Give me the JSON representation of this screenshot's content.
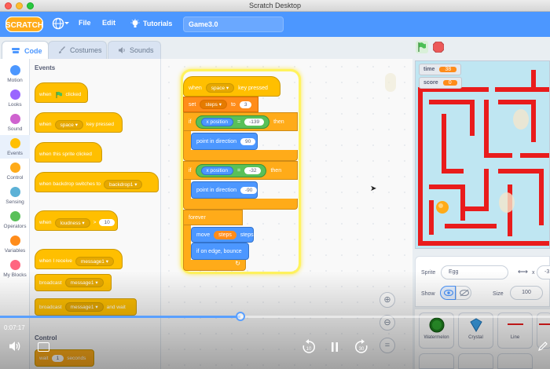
{
  "window": {
    "title": "Scratch Desktop"
  },
  "menu": {
    "logo": "SCRATCH",
    "file": "File",
    "edit": "Edit",
    "tutorials": "Tutorials",
    "project_title": "Game3.0"
  },
  "tabs": {
    "code": "Code",
    "costumes": "Costumes",
    "sounds": "Sounds"
  },
  "categories": [
    {
      "label": "Motion",
      "color": "#4c97ff"
    },
    {
      "label": "Looks",
      "color": "#9966ff"
    },
    {
      "label": "Sound",
      "color": "#cf63cf"
    },
    {
      "label": "Events",
      "color": "#ffbf00"
    },
    {
      "label": "Control",
      "color": "#ffab19"
    },
    {
      "label": "Sensing",
      "color": "#5cb1d6"
    },
    {
      "label": "Operators",
      "color": "#59c059"
    },
    {
      "label": "Variables",
      "color": "#ff8c1a"
    },
    {
      "label": "My Blocks",
      "color": "#ff6680"
    }
  ],
  "palette": {
    "events_title": "Events",
    "control_title": "Control",
    "when": "when",
    "clicked": "clicked",
    "space": "space",
    "key_pressed": "key pressed",
    "when_sprite_clicked": "when this sprite clicked",
    "when_backdrop": "when backdrop switches to",
    "backdrop1": "backdrop1",
    "loudness": "loudness",
    "gt": ">",
    "loud_val": "10",
    "when_i_receive": "when I receive",
    "message1": "message1",
    "broadcast": "broadcast",
    "and_wait": "and wait",
    "wait": "wait",
    "wait_val": "1",
    "seconds": "seconds"
  },
  "script": {
    "when": "when",
    "key": "space",
    "key_pressed": "key pressed",
    "set": "set",
    "var": "steps",
    "to": "to",
    "set_val": "3",
    "if1": "if",
    "x_position": "x position",
    "eq": "=",
    "if1_val": "-139",
    "then": "then",
    "point_in_direction": "point in direction",
    "dir1": "90",
    "if2": "if",
    "if2_val": "-32",
    "dir2": "-90",
    "forever": "forever",
    "move": "move",
    "steps_label": "steps",
    "on_edge_bounce": "if on edge, bounce"
  },
  "video": {
    "timecode": "0:07:17",
    "progress": 0.437
  },
  "stage": {
    "monitors": [
      {
        "label": "time",
        "value": "38"
      },
      {
        "label": "score",
        "value": "0"
      }
    ]
  },
  "sprite_info": {
    "sprite_label": "Sprite",
    "sprite_name": "Egg",
    "x_label": "x",
    "x_value": "-3",
    "show_label": "Show",
    "size_label": "Size",
    "size_value": "100"
  },
  "sprites": [
    {
      "name": "Watermelon"
    },
    {
      "name": "Crystal"
    },
    {
      "name": "Line"
    }
  ]
}
